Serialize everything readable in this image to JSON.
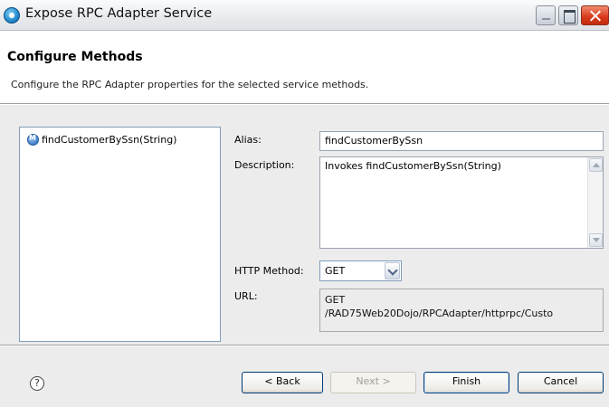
{
  "window": {
    "title": "Expose RPC Adapter Service"
  },
  "header": {
    "title": "Configure Methods",
    "description": "Configure the RPC Adapter properties for the selected service methods."
  },
  "methods": [
    {
      "label": "findCustomerBySsn(String)",
      "icon": "method-icon"
    }
  ],
  "form": {
    "alias_label": "Alias:",
    "alias_value": "findCustomerBySsn",
    "description_label": "Description:",
    "description_value": "Invokes findCustomerBySsn(String)",
    "http_method_label": "HTTP Method:",
    "http_method_value": "GET",
    "url_label": "URL:",
    "url_line1": "GET",
    "url_line2": "/RAD75Web20Dojo/RPCAdapter/httprpc/Custo"
  },
  "footer": {
    "help_glyph": "?",
    "back_label": "< Back",
    "next_label": "Next >",
    "finish_label": "Finish",
    "cancel_label": "Cancel"
  }
}
